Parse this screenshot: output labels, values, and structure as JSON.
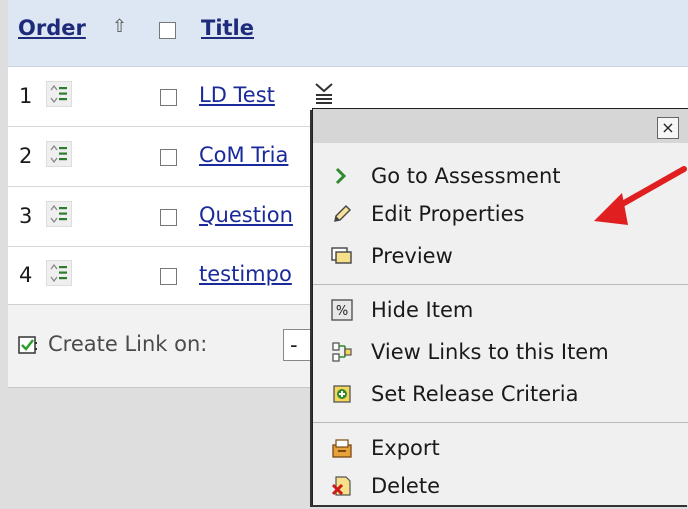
{
  "header": {
    "order_label": "Order",
    "title_label": "Title"
  },
  "rows": [
    {
      "num": "1",
      "title": "LD Test"
    },
    {
      "num": "2",
      "title": "CoM Tria"
    },
    {
      "num": "3",
      "title": "Question"
    },
    {
      "num": "4",
      "title": "testimpo"
    }
  ],
  "footer": {
    "label": "Create Link on:",
    "select_value": "-"
  },
  "context_menu": {
    "close": "×",
    "items": [
      {
        "label": "Go to Assessment",
        "icon": "chevron-right-icon"
      },
      {
        "label": "Edit Properties",
        "icon": "pencil-icon"
      },
      {
        "label": "Preview",
        "icon": "preview-icon"
      },
      {
        "label": "Hide Item",
        "icon": "hide-icon"
      },
      {
        "label": "View Links to this Item",
        "icon": "links-icon"
      },
      {
        "label": "Set Release Criteria",
        "icon": "release-criteria-icon"
      },
      {
        "label": "Export",
        "icon": "export-icon"
      },
      {
        "label": "Delete",
        "icon": "delete-icon"
      }
    ]
  },
  "colors": {
    "header_bg": "#dde6f3",
    "link": "#1a2a9a",
    "annotation_arrow": "#e02020"
  }
}
